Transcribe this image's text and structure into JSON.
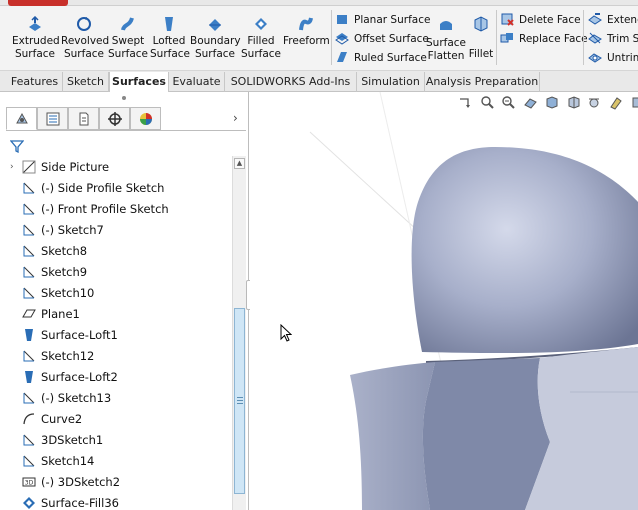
{
  "ribbon": {
    "buttons": [
      {
        "label1": "Extruded",
        "label2": "Surface",
        "icon": "extruded-surface-icon"
      },
      {
        "label1": "Revolved",
        "label2": "Surface",
        "icon": "revolved-surface-icon"
      },
      {
        "label1": "Swept",
        "label2": "Surface",
        "icon": "swept-surface-icon"
      },
      {
        "label1": "Lofted",
        "label2": "Surface",
        "icon": "lofted-surface-icon"
      },
      {
        "label1": "Boundary",
        "label2": "Surface",
        "icon": "boundary-surface-icon"
      },
      {
        "label1": "Filled",
        "label2": "Surface",
        "icon": "filled-surface-icon"
      },
      {
        "label1": "Freeform",
        "label2": "",
        "icon": "freeform-icon"
      }
    ],
    "small_buttons": [
      {
        "label": "Planar Surface",
        "icon": "planar-surface-icon"
      },
      {
        "label": "Offset Surface",
        "icon": "offset-surface-icon"
      },
      {
        "label": "Ruled Surface",
        "icon": "ruled-surface-icon"
      }
    ],
    "flatten": {
      "label1": "Surface",
      "label2": "Flatten",
      "icon": "surface-flatten-icon"
    },
    "fillet": {
      "label": "Fillet",
      "icon": "fillet-icon"
    },
    "face_buttons": [
      {
        "label": "Delete Face",
        "icon": "delete-face-icon"
      },
      {
        "label": "Replace Face",
        "icon": "replace-face-icon"
      }
    ],
    "right_buttons": [
      {
        "label": "Extend",
        "icon": "extend-surface-icon"
      },
      {
        "label": "Trim Su",
        "icon": "trim-surface-icon"
      },
      {
        "label": "Untrim",
        "icon": "untrim-surface-icon"
      }
    ]
  },
  "tabs": [
    {
      "label": "Features"
    },
    {
      "label": "Sketch"
    },
    {
      "label": "Surfaces",
      "active": true
    },
    {
      "label": "Evaluate"
    },
    {
      "label": "SOLIDWORKS Add-Ins"
    },
    {
      "label": "Simulation"
    },
    {
      "label": "Analysis Preparation"
    }
  ],
  "tree": {
    "items": [
      {
        "label": "Side Picture",
        "icon": "sketch-picture-icon"
      },
      {
        "label": "(-) Side Profile Sketch",
        "icon": "sketch-icon"
      },
      {
        "label": "(-) Front Profile Sketch",
        "icon": "sketch-icon"
      },
      {
        "label": "(-) Sketch7",
        "icon": "sketch-icon"
      },
      {
        "label": "Sketch8",
        "icon": "sketch-icon"
      },
      {
        "label": "Sketch9",
        "icon": "sketch-icon"
      },
      {
        "label": "Sketch10",
        "icon": "sketch-icon"
      },
      {
        "label": "Plane1",
        "icon": "plane-icon"
      },
      {
        "label": "Surface-Loft1",
        "icon": "surface-loft-icon"
      },
      {
        "label": "Sketch12",
        "icon": "sketch-icon"
      },
      {
        "label": "Surface-Loft2",
        "icon": "surface-loft-icon"
      },
      {
        "label": "(-) Sketch13",
        "icon": "sketch-icon"
      },
      {
        "label": "Curve2",
        "icon": "curve-icon"
      },
      {
        "label": "3DSketch1",
        "icon": "sketch-icon"
      },
      {
        "label": "Sketch14",
        "icon": "sketch-icon"
      },
      {
        "label": "(-) 3DSketch2",
        "icon": "3d-sketch-icon"
      },
      {
        "label": "Surface-Fill36",
        "icon": "surface-fill-icon"
      }
    ]
  },
  "colors": {
    "surface_shade": "#9aa4c0",
    "accent_blue": "#1f5aa8",
    "scroll_thumb": "#cfe6f6"
  }
}
